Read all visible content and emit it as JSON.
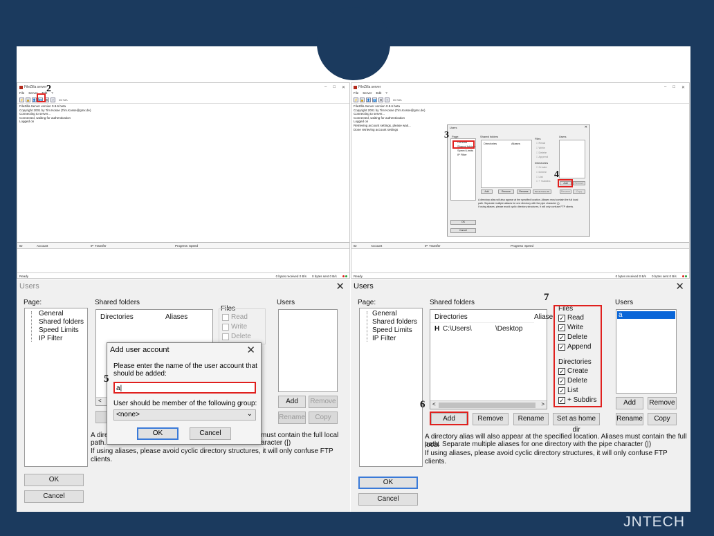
{
  "brand": "JNTECH",
  "steps": [
    "2",
    "3",
    "4",
    "5",
    "6",
    "7"
  ],
  "fz": {
    "title": "FileZilla server",
    "menu": [
      "File",
      "Server",
      "Edit",
      "?"
    ],
    "toolbar_extra": "/C/ \\\\C\\",
    "log_left": [
      "FileZilla Server version 0.9.6 beta",
      "Copyright 2001 by Tim Kosse (Tim.Kosse@gmx.de)",
      "Connecting to server...",
      "Connected, waiting for authentication",
      "Logged on"
    ],
    "log_right": [
      "FileZilla Server version 0.9.6 beta",
      "Copyright 2001 by Tim Kosse (Tim.Kosse@gmx.de)",
      "Connecting to server...",
      "Connected, waiting for authentication",
      "Logged on",
      "Retrieving account settings, please wait...",
      "Done retrieving account settings"
    ],
    "queue_cols": [
      "ID",
      "Account",
      "IP",
      "Transfer",
      "Progress",
      "Speed"
    ],
    "status_ready": "Ready",
    "status_recv": "0 bytes received  0 B/s",
    "status_sent": "0 bytes sent  0 B/s",
    "colors": {
      "red": "#e0201e",
      "green": "#22a039"
    }
  },
  "mini": {
    "title": "Users",
    "page": "Page:",
    "pages": [
      "General",
      "Shared folders",
      "Speed Limits",
      "IP Filter"
    ],
    "shared": "Shared folders",
    "cols": [
      "Directories",
      "Aliases"
    ],
    "files": "Files",
    "file_items": [
      "Read",
      "Write",
      "Delete",
      "Append"
    ],
    "dirs": "Directories",
    "dir_items": [
      "Create",
      "Delete",
      "List",
      "+ Subdirs"
    ],
    "users": "Users",
    "btns": [
      "Add",
      "Remove",
      "Rename",
      "Set as home dir"
    ],
    "user_btns": [
      "Add",
      "Remove",
      "Rename",
      "Copy"
    ],
    "note1": "A directory alias will also appear at the specified location. Aliases must contain the full local path. Separate multiple aliases for one directory with the pipe character (|)",
    "note2": "If using aliases, please avoid cyclic directory structures, it will only confuse FTP clients.",
    "ok": "OK",
    "cancel": "Cancel"
  },
  "users_left": {
    "title": "Users",
    "page_label": "Page:",
    "pages": [
      "General",
      "Shared folders",
      "Speed Limits",
      "IP Filter"
    ],
    "shared_label": "Shared folders",
    "col_dirs": "Directories",
    "col_alias": "Aliases",
    "files_label": "Files",
    "file_items": [
      "Read",
      "Write",
      "Delete"
    ],
    "users_label": "Users",
    "add": "Add",
    "remove": "Remove",
    "rename": "Rename",
    "copy": "Copy",
    "note1_a": "A dire",
    "note1_b": "must contain the full local",
    "note2_a": "path. S",
    "note2_b": "aracter (|)",
    "note3": "If using aliases, please avoid cyclic directory structures, it will only confuse FTP clients.",
    "ok": "OK",
    "cancel": "Cancel"
  },
  "add_user": {
    "title": "Add user account",
    "prompt": "Please enter the name of the user account that should be added:",
    "value": "a",
    "group_label": "User should be member of the following group:",
    "group_value": "<none>",
    "ok": "OK",
    "cancel": "Cancel"
  },
  "users_right": {
    "title": "Users",
    "page_label": "Page:",
    "pages": [
      "General",
      "Shared folders",
      "Speed Limits",
      "IP Filter"
    ],
    "shared_label": "Shared folders",
    "col_dirs": "Directories",
    "col_alias": "Aliase",
    "row_flag": "H",
    "row_path": "C:\\Users\\",
    "row_sub": "\\Desktop",
    "files_label": "Files",
    "file_items": [
      "Read",
      "Write",
      "Delete",
      "Append"
    ],
    "dirs_label": "Directories",
    "dir_items": [
      "Create",
      "Delete",
      "List",
      "+ Subdirs"
    ],
    "users_label": "Users",
    "user_entry": "a",
    "add_dir": "Add",
    "remove_dir": "Remove",
    "rename_dir": "Rename",
    "home_dir": "Set as home dir",
    "add": "Add",
    "remove": "Remove",
    "rename": "Rename",
    "copy": "Copy",
    "note1": "A directory alias will also appear at the specified location. Aliases must contain the full local",
    "note2": "path. Separate multiple aliases for one directory with the pipe character (|)",
    "note3": "If using aliases, please avoid cyclic directory structures, it will only confuse FTP clients.",
    "ok": "OK",
    "cancel": "Cancel"
  }
}
